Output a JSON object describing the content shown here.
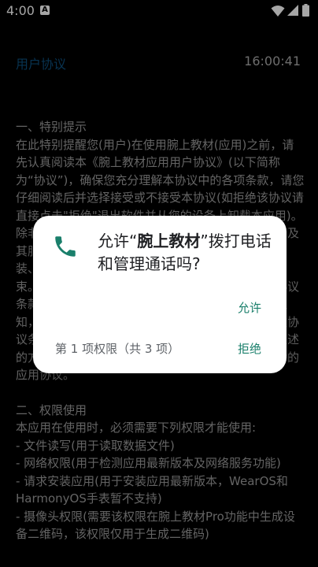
{
  "status_bar": {
    "time": "4:00",
    "notification_icon": "A"
  },
  "header": {
    "title": "用户协议",
    "time": "16:00:41"
  },
  "agreement": {
    "section1_heading": "一、特别提示",
    "section1_body": "在此特别提醒您(用户)在使用腕上教材(应用)之前，请先认真阅读本《腕上教材应用用户协议》(以下简称为“协议”)，确保您充分理解本协议中的各项条款，请您仔细阅读后并选择接受或不接受本协议(如拒绝该协议请直接点击\"拒绝\"退出软件并从您的设备上卸载本应用)。除非您接受本协议所有条款，否则您无权使用本应用及其服务。本应用可能会向您提供广告。您的下载、安装、使用等行为即视为您已阅读并同意上述协议的约束。本协议可由本应用开发者随时更新，更新后的协议条款一旦公布即代替原来的协议条款，恕不再另行通知，用户可在本应用中查阅最新版协议条款。在修改协议条款后，如果用户不接受修改后的协议，请按照上述的方法进行处理，若用户继续使用则代表同意修改后的应用协议。",
    "section2_heading": "二、权限使用",
    "section2_intro": "本应用在使用时，必须需要下列权限才能使用:",
    "permissions": [
      "- 文件读写(用于读取数据文件)",
      "- 网络权限(用于检测应用最新版本及网络服务功能)",
      "- 请求安装应用(用于安装应用最新版本，WearOS和HarmonyOS手表暂不支持)",
      "- 摄像头权限(需要该权限在腕上教材Pro功能中生成设备二维码，该权限仅用于生成二维码)"
    ]
  },
  "dialog": {
    "message_prefix": "允许“",
    "app_name": "腕上教材",
    "message_suffix": "”拨打电话和管理通话吗?",
    "allow_label": "允许",
    "deny_label": "拒绝",
    "counter": "第 1 项权限（共 3 项）",
    "icon": "phone-icon",
    "accent_color": "#1a7f6b"
  }
}
